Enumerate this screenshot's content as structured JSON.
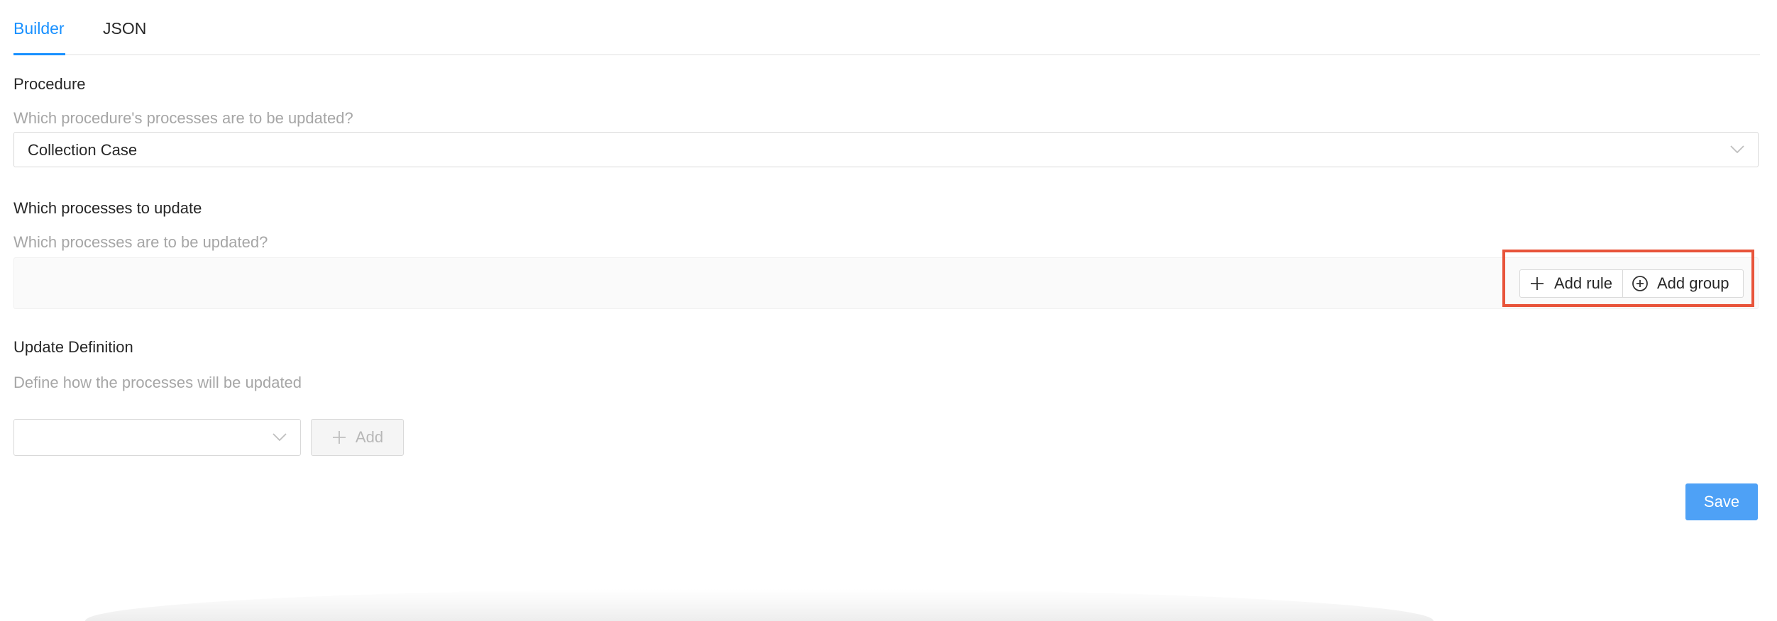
{
  "tabs": [
    {
      "label": "Builder",
      "active": true
    },
    {
      "label": "JSON",
      "active": false
    }
  ],
  "procedure": {
    "title": "Procedure",
    "description": "Which procedure's processes are to be updated?",
    "selected_value": "Collection Case"
  },
  "processes": {
    "title": "Which processes to update",
    "description": "Which processes are to be updated?",
    "add_rule_label": "Add rule",
    "add_group_label": "Add group"
  },
  "update_definition": {
    "title": "Update Definition",
    "description": "Define how the processes will be updated",
    "select_value": "",
    "add_label": "Add"
  },
  "actions": {
    "save_label": "Save"
  },
  "colors": {
    "accent": "#1890ff",
    "save_button": "#4ea1f6",
    "highlight": "#e8543a",
    "muted_text": "#a6a6a6",
    "border": "#d9d9d9"
  },
  "icons": {
    "select_chevron": "chevron-down-icon",
    "add_rule": "plus-icon",
    "add_group": "plus-circle-icon",
    "add": "plus-icon"
  }
}
